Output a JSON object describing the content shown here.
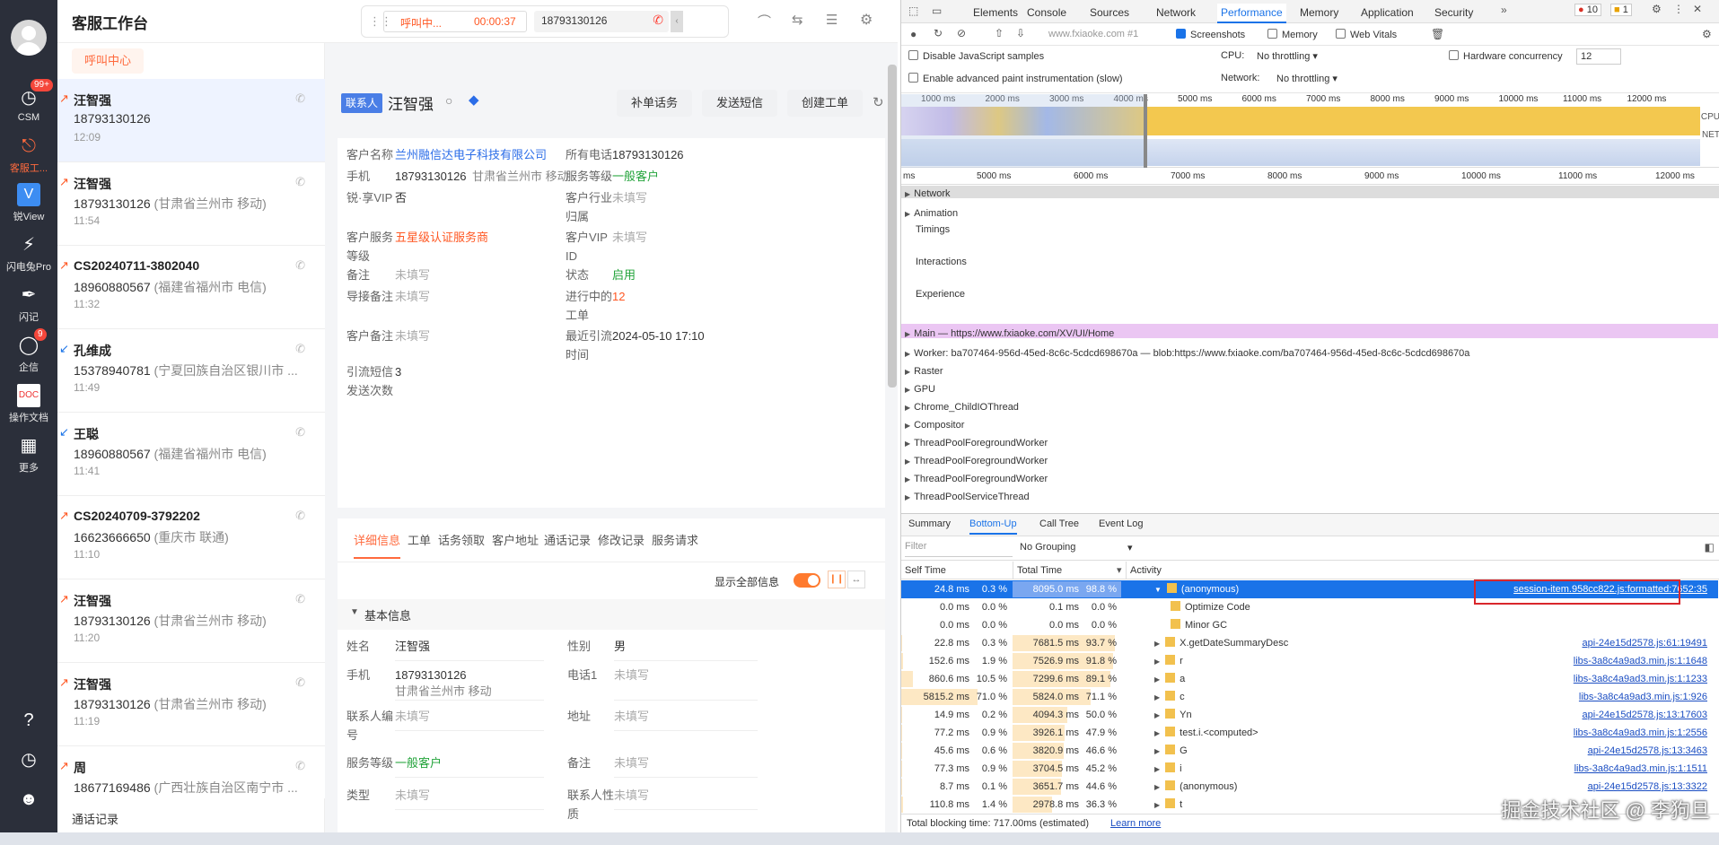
{
  "app": {
    "title": "客服工作台"
  },
  "rail": {
    "items": [
      {
        "label": "CSM",
        "badge": "99+"
      },
      {
        "label": "客服工..."
      },
      {
        "label": "锐View"
      },
      {
        "label": "闪电兔Pro"
      },
      {
        "label": "闪记"
      },
      {
        "label": "企信",
        "badge": "9"
      },
      {
        "label": "操作文档"
      },
      {
        "label": "更多"
      }
    ]
  },
  "callbar": {
    "status": "呼叫中...",
    "timer": "00:00:37",
    "number": "18793130126"
  },
  "list": {
    "tab": "呼叫中心",
    "footer": "通话记录",
    "calls": [
      {
        "name": "汪智强",
        "phone": "18793130126",
        "loc": "",
        "time": "12:09",
        "dir": "out"
      },
      {
        "name": "汪智强",
        "phone": "18793130126",
        "loc": "(甘肃省兰州市 移动)",
        "time": "11:54",
        "dir": "out"
      },
      {
        "name": "CS20240711-3802040",
        "phone": "18960880567",
        "loc": "(福建省福州市 电信)",
        "time": "11:32",
        "dir": "out"
      },
      {
        "name": "孔维成",
        "phone": "15378940781",
        "loc": "(宁夏回族自治区银川市 ...",
        "time": "11:49",
        "dir": "in"
      },
      {
        "name": "王聪",
        "phone": "18960880567",
        "loc": "(福建省福州市 电信)",
        "time": "11:41",
        "dir": "in"
      },
      {
        "name": "CS20240709-3792202",
        "phone": "16623666650",
        "loc": "(重庆市 联通)",
        "time": "11:10",
        "dir": "out"
      },
      {
        "name": "汪智强",
        "phone": "18793130126",
        "loc": "(甘肃省兰州市 移动)",
        "time": "11:20",
        "dir": "out"
      },
      {
        "name": "汪智强",
        "phone": "18793130126",
        "loc": "(甘肃省兰州市 移动)",
        "time": "11:19",
        "dir": "out"
      },
      {
        "name": "周",
        "phone": "18677169486",
        "loc": "(广西壮族自治区南宁市 ...",
        "time": "",
        "dir": "out"
      }
    ]
  },
  "contact": {
    "tag": "联系人",
    "name": "汪智强",
    "actions": [
      "补单话务",
      "发送短信",
      "创建工单"
    ],
    "fields_left": [
      {
        "label": "客户名称",
        "value": "兰州融信达电子科技有限公司",
        "style": "link"
      },
      {
        "label": "手机",
        "value": "18793130126",
        "extra": "甘肃省兰州市 移动"
      },
      {
        "label": "锐·享VIP",
        "value": "否"
      },
      {
        "label": "客户服务等级",
        "value": "五星级认证服务商",
        "style": "orange"
      },
      {
        "label": "备注",
        "value": "未填写",
        "style": "gray"
      },
      {
        "label": "导接备注",
        "value": "未填写",
        "style": "gray"
      },
      {
        "label": "客户备注",
        "value": "未填写",
        "style": "gray"
      },
      {
        "label": "引流短信发送次数",
        "value": "3"
      }
    ],
    "fields_right": [
      {
        "label": "所有电话",
        "value": "18793130126"
      },
      {
        "label": "服务等级",
        "value": "一般客户",
        "style": "green"
      },
      {
        "label": "客户行业归属",
        "value": "未填写",
        "style": "gray"
      },
      {
        "label": "客户VIP ID",
        "value": "未填写",
        "style": "gray"
      },
      {
        "label": "状态",
        "value": "启用",
        "style": "green"
      },
      {
        "label": "进行中的工单",
        "value": "12",
        "style": "orange"
      },
      {
        "label": "最近引流时间",
        "value": "2024-05-10 17:10"
      }
    ]
  },
  "detail": {
    "tabs": [
      "详细信息",
      "工单",
      "话务领取",
      "客户地址",
      "通话记录",
      "修改记录",
      "服务请求"
    ],
    "show_all": "显示全部信息",
    "section": "基本信息",
    "rows": [
      {
        "l1": "姓名",
        "v1": "汪智强",
        "l2": "性别",
        "v2": "男"
      },
      {
        "l1": "手机",
        "v1": "18793130126",
        "v1b": "甘肃省兰州市 移动",
        "l2": "电话1",
        "v2": "未填写"
      },
      {
        "l1": "联系人编号",
        "v1": "未填写",
        "l2": "地址",
        "v2": "未填写"
      },
      {
        "l1": "服务等级",
        "v1": "一般客户",
        "l2": "备注",
        "v2": "未填写"
      },
      {
        "l1": "类型",
        "v1": "未填写",
        "l2": "联系人性质",
        "v2": "未填写"
      }
    ]
  },
  "devtools": {
    "tabs": [
      "Elements",
      "Console",
      "Sources",
      "Network",
      "Performance",
      "Memory",
      "Application",
      "Security"
    ],
    "errors": "10",
    "warnings": "1",
    "url": "www.fxiaoke.com #1",
    "opts": {
      "screenshots": "Screenshots",
      "memory": "Memory",
      "webvitals": "Web Vitals",
      "disable_js": "Disable JavaScript samples",
      "paint": "Enable advanced paint instrumentation (slow)",
      "cpu": "CPU:",
      "cpu_val": "No throttling",
      "net": "Network:",
      "net_val": "No throttling",
      "hw": "Hardware concurrency",
      "hw_val": "12"
    },
    "overview_ticks": [
      "1000 ms",
      "2000 ms",
      "3000 ms",
      "4000 ms",
      "5000 ms",
      "6000 ms",
      "7000 ms",
      "8000 ms",
      "9000 ms",
      "10000 ms",
      "11000 ms",
      "12000 ms"
    ],
    "cpu_label": "CPU",
    "net_label": "NET",
    "ruler_ticks": [
      "ms",
      "5000 ms",
      "6000 ms",
      "7000 ms",
      "8000 ms",
      "9000 ms",
      "10000 ms",
      "11000 ms",
      "12000 ms"
    ],
    "threads": [
      "Network",
      "Animation",
      "Timings",
      "Interactions",
      "Experience",
      "Main — https://www.fxiaoke.com/XV/UI/Home",
      "Worker: ba707464-956d-45ed-8c6c-5cdcd698670a — blob:https://www.fxiaoke.com/ba707464-956d-45ed-8c6c-5cdcd698670a",
      "Raster",
      "GPU",
      "Chrome_ChildIOThread",
      "Compositor",
      "ThreadPoolForegroundWorker",
      "ThreadPoolForegroundWorker",
      "ThreadPoolForegroundWorker",
      "ThreadPoolServiceThread"
    ],
    "bottom_tabs": [
      "Summary",
      "Bottom-Up",
      "Call Tree",
      "Event Log"
    ],
    "filter": "Filter",
    "grouping": "No Grouping",
    "cols": [
      "Self Time",
      "Total Time",
      "Activity"
    ],
    "rows": [
      {
        "self": "24.8 ms",
        "selfp": "0.3 %",
        "total": "8095.0 ms",
        "totalp": "98.8 %",
        "act": "(anonymous)",
        "src": "session-item.958cc822.js:formatted:7652:35"
      },
      {
        "self": "0.0 ms",
        "selfp": "0.0 %",
        "total": "0.1 ms",
        "totalp": "0.0 %",
        "act": "Optimize Code",
        "src": ""
      },
      {
        "self": "0.0 ms",
        "selfp": "0.0 %",
        "total": "0.0 ms",
        "totalp": "0.0 %",
        "act": "Minor GC",
        "src": ""
      },
      {
        "self": "22.8 ms",
        "selfp": "0.3 %",
        "total": "7681.5 ms",
        "totalp": "93.7 %",
        "act": "X.getDateSummaryDesc",
        "src": "api-24e15d2578.js:61:19491"
      },
      {
        "self": "152.6 ms",
        "selfp": "1.9 %",
        "total": "7526.9 ms",
        "totalp": "91.8 %",
        "act": "r",
        "src": "libs-3a8c4a9ad3.min.js:1:1648"
      },
      {
        "self": "860.6 ms",
        "selfp": "10.5 %",
        "total": "7299.6 ms",
        "totalp": "89.1 %",
        "act": "a",
        "src": "libs-3a8c4a9ad3.min.js:1:1233"
      },
      {
        "self": "5815.2 ms",
        "selfp": "71.0 %",
        "total": "5824.0 ms",
        "totalp": "71.1 %",
        "act": "c",
        "src": "libs-3a8c4a9ad3.min.js:1:926"
      },
      {
        "self": "14.9 ms",
        "selfp": "0.2 %",
        "total": "4094.3 ms",
        "totalp": "50.0 %",
        "act": "Yn",
        "src": "api-24e15d2578.js:13:17603"
      },
      {
        "self": "77.2 ms",
        "selfp": "0.9 %",
        "total": "3926.1 ms",
        "totalp": "47.9 %",
        "act": "test.i.<computed>",
        "src": "libs-3a8c4a9ad3.min.js:1:2556"
      },
      {
        "self": "45.6 ms",
        "selfp": "0.6 %",
        "total": "3820.9 ms",
        "totalp": "46.6 %",
        "act": "G",
        "src": "api-24e15d2578.js:13:3463"
      },
      {
        "self": "77.3 ms",
        "selfp": "0.9 %",
        "total": "3704.5 ms",
        "totalp": "45.2 %",
        "act": "i",
        "src": "libs-3a8c4a9ad3.min.js:1:1511"
      },
      {
        "self": "8.7 ms",
        "selfp": "0.1 %",
        "total": "3651.7 ms",
        "totalp": "44.6 %",
        "act": "(anonymous)",
        "src": "api-24e15d2578.js:13:3322"
      },
      {
        "self": "110.8 ms",
        "selfp": "1.4 %",
        "total": "2978.8 ms",
        "totalp": "36.3 %",
        "act": "t",
        "src": ""
      }
    ],
    "tbt": "Total blocking time: 717.00ms (estimated)",
    "learn": "Learn more"
  },
  "watermark": "掘金技术社区 @ 李狗旦"
}
